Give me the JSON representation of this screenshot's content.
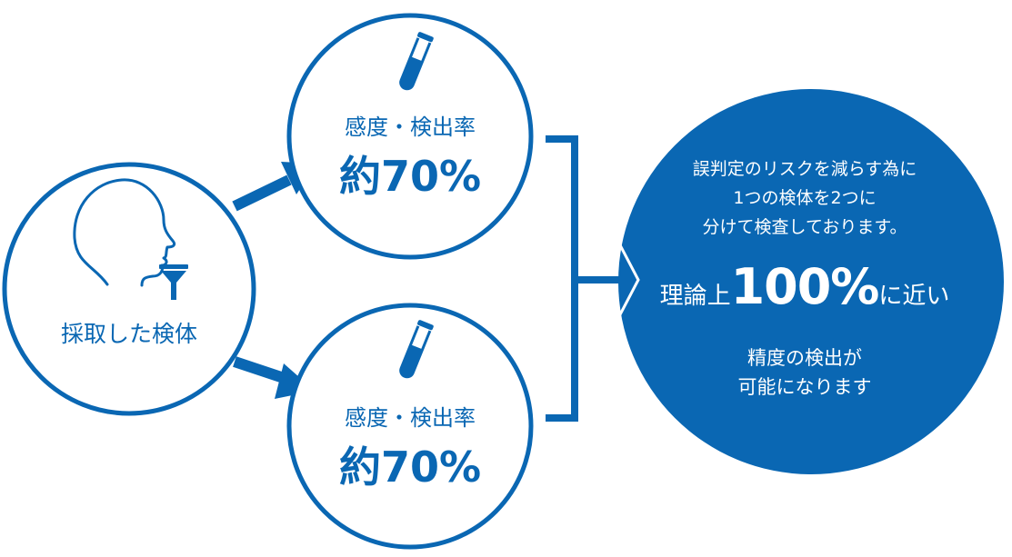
{
  "source": {
    "label": "採取した検体"
  },
  "branches": [
    {
      "label": "感度・検出率",
      "value": "約70%"
    },
    {
      "label": "感度・検出率",
      "value": "約70%"
    }
  ],
  "result": {
    "lines": [
      "誤判定のリスクを減らす為に",
      "1つの検体を2つに",
      "分けて検査しております。"
    ],
    "headline_prefix": "理論上",
    "headline_number": "100%",
    "headline_suffix": "に近い",
    "bottom_lines": [
      "精度の検出が",
      "可能になります"
    ]
  },
  "colors": {
    "accent": "#0a67b3",
    "background": "#ffffff",
    "text_on_accent": "#ffffff"
  },
  "icons": [
    "person-profile-icon",
    "funnel-icon",
    "test-tube-icon",
    "test-tube-icon"
  ]
}
